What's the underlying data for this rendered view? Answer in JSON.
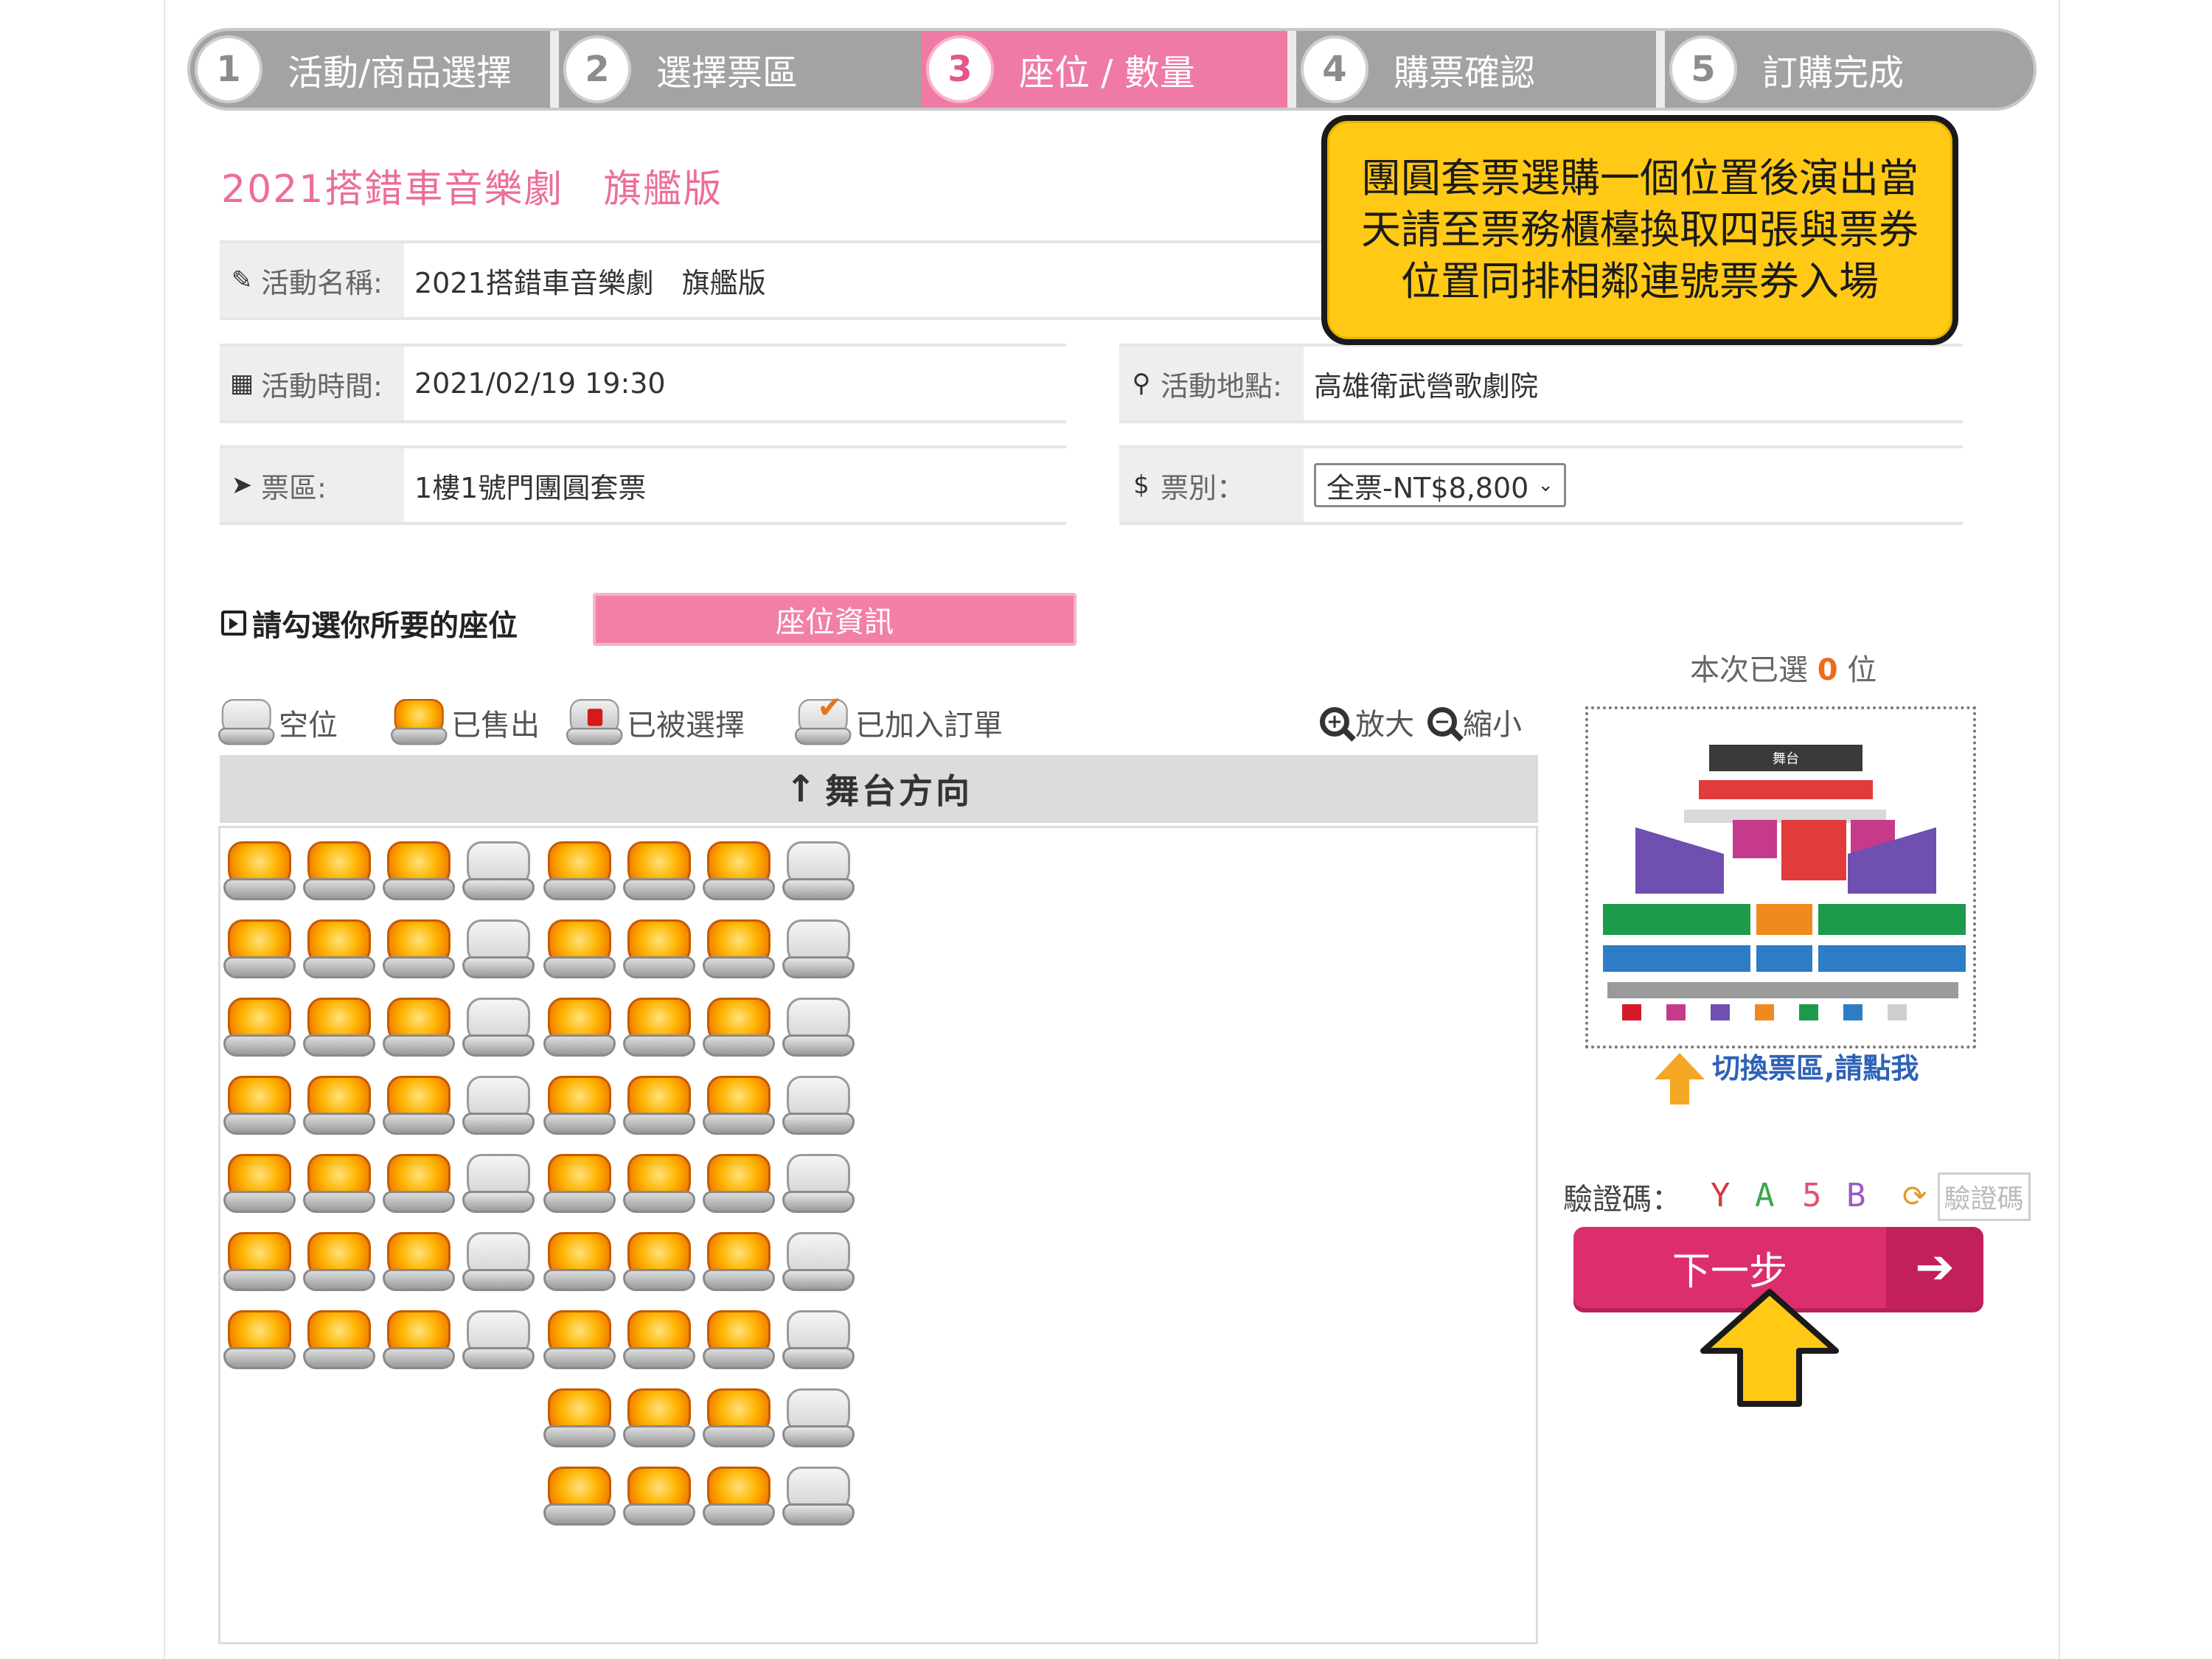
{
  "steps": [
    {
      "num": "1",
      "label": "活動/商品選擇"
    },
    {
      "num": "2",
      "label": "選擇票區"
    },
    {
      "num": "3",
      "label": "座位 / 數量"
    },
    {
      "num": "4",
      "label": "購票確認"
    },
    {
      "num": "5",
      "label": "訂購完成"
    }
  ],
  "active_step": "3",
  "event_title": "2021搭錯車音樂劇　旗艦版",
  "callout": "團圓套票選購一個位置後演出當天請至票務櫃檯換取四張與票券位置同排相鄰連號票券入場",
  "info": {
    "name_label": "活動名稱:",
    "name_value": "2021搭錯車音樂劇　旗艦版",
    "time_label": "活動時間:",
    "time_value": "2021/02/19 19:30",
    "venue_label": "活動地點:",
    "venue_value": "高雄衛武營歌劇院",
    "area_label": "票區:",
    "area_value": "1樓1號門團圓套票",
    "type_label": "票別：",
    "type_value": "全票-NT$8,800"
  },
  "choose_seat_label": "請勾選你所要的座位",
  "seat_info_button": "座位資訊",
  "legend": {
    "empty": "空位",
    "sold": "已售出",
    "selected": "已被選擇",
    "ordered": "已加入訂單"
  },
  "zoom": {
    "in": "放大",
    "out": "縮小"
  },
  "stage_direction": "舞台方向",
  "seat_rows": [
    [
      "sold",
      "sold",
      "sold",
      "empty",
      "sold",
      "sold",
      "sold",
      "empty"
    ],
    [
      "sold",
      "sold",
      "sold",
      "empty",
      "sold",
      "sold",
      "sold",
      "empty"
    ],
    [
      "sold",
      "sold",
      "sold",
      "empty",
      "sold",
      "sold",
      "sold",
      "empty"
    ],
    [
      "sold",
      "sold",
      "sold",
      "empty",
      "sold",
      "sold",
      "sold",
      "empty"
    ],
    [
      "sold",
      "sold",
      "sold",
      "empty",
      "sold",
      "sold",
      "sold",
      "empty"
    ],
    [
      "sold",
      "sold",
      "sold",
      "empty",
      "sold",
      "sold",
      "sold",
      "empty"
    ],
    [
      "sold",
      "sold",
      "sold",
      "empty",
      "sold",
      "sold",
      "sold",
      "empty"
    ],
    [
      "none",
      "none",
      "none",
      "none",
      "sold",
      "sold",
      "sold",
      "empty"
    ],
    [
      "none",
      "none",
      "none",
      "none",
      "sold",
      "sold",
      "sold",
      "empty"
    ]
  ],
  "selected_count": {
    "prefix": "本次已選 ",
    "count": "0",
    "suffix": " 位"
  },
  "minimap_stage": "舞台",
  "switch_area": "切換票區,請點我",
  "captcha": {
    "label": "驗證碼：",
    "chars": [
      "Y",
      "A",
      "5",
      "B"
    ],
    "char_colors": [
      "#d9363e",
      "#3aa64a",
      "#e0536f",
      "#9a5cc8"
    ],
    "input_placeholder": "驗證碼"
  },
  "next_button": "下一步",
  "colors": {
    "pink": "#ec6e98",
    "next_button": "#dc2e6c",
    "callout_bg": "#ffc915"
  }
}
